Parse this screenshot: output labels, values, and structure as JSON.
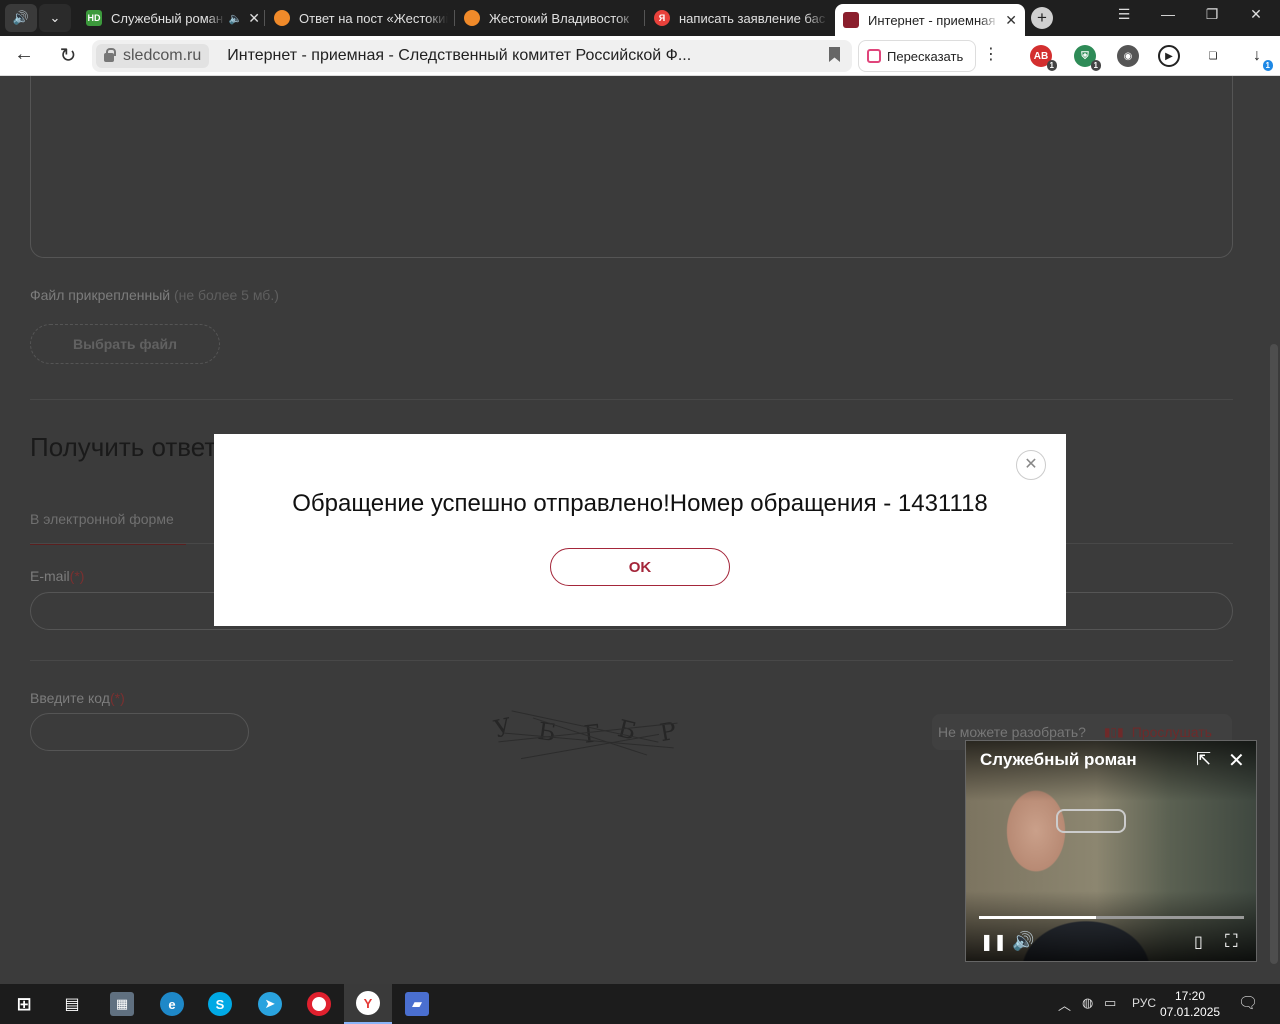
{
  "browser": {
    "tabs": [
      {
        "title": "Служебный роман",
        "favicon": "hd-icon",
        "sound": true
      },
      {
        "title": "Ответ на пост «Жестокий",
        "favicon": "pikabu-icon"
      },
      {
        "title": "Жестокий Владивосток",
        "favicon": "pikabu-icon"
      },
      {
        "title": "написать заявление бас",
        "favicon": "yandex-icon"
      },
      {
        "title": "Интернет - приемная",
        "favicon": "sledcom-icon",
        "active": true
      }
    ],
    "address": {
      "domain": "sledcom.ru",
      "page_title": "Интернет - приемная - Следственный комитет Российской Ф..."
    },
    "retell_label": "Пересказать",
    "extensions": [
      {
        "name": "adblock-icon",
        "badge": "1"
      },
      {
        "name": "shield-icon",
        "badge": "1"
      },
      {
        "name": "planet-icon"
      },
      {
        "name": "media-icon"
      },
      {
        "name": "collections-icon"
      },
      {
        "name": "downloads-icon",
        "badge": "1"
      }
    ]
  },
  "page": {
    "file_label": "Файл прикрепленный",
    "file_note": "(не более 5 мб.)",
    "file_button": "Выбрать файл",
    "section_title": "Получить ответ",
    "tab_electronic": "В электронной форме",
    "email_label": "E-mail",
    "required_mark": "(*)",
    "code_label": "Введите код",
    "captcha_chars": [
      "У",
      "Б",
      "Г",
      "Б",
      "Р"
    ],
    "hint_text": "Не можете разобрать?",
    "listen_label": "Прослушать"
  },
  "modal": {
    "message": "Обращение успешно отправлено!Номер обращения - 1431118",
    "ok_label": "OK"
  },
  "pip": {
    "title": "Служебный роман",
    "progress": 0.44
  },
  "taskbar": {
    "language": "РУС",
    "time": "17:20",
    "date": "07.01.2025"
  },
  "colors": {
    "accent": "#a4263a",
    "overlay": "#3b3b3b"
  }
}
